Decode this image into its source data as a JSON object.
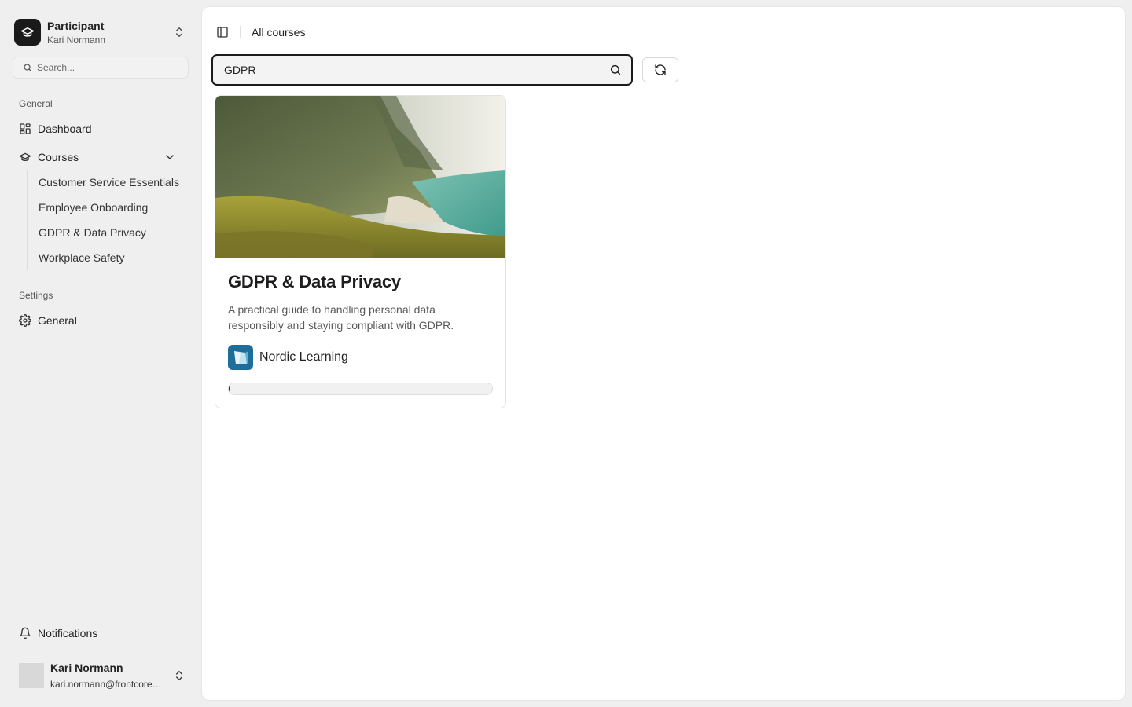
{
  "org": {
    "title": "Participant",
    "subtitle": "Kari Normann"
  },
  "sidebar": {
    "search_placeholder": "Search...",
    "general_label": "General",
    "dashboard_label": "Dashboard",
    "courses_label": "Courses",
    "course_items": [
      {
        "label": "Customer Service Essentials"
      },
      {
        "label": "Employee Onboarding"
      },
      {
        "label": "GDPR & Data Privacy"
      },
      {
        "label": "Workplace Safety"
      }
    ],
    "settings_label": "Settings",
    "settings_general_label": "General",
    "notifications_label": "Notifications"
  },
  "user": {
    "name": "Kari Normann",
    "email": "kari.normann@frontcore.com"
  },
  "header": {
    "breadcrumb": "All courses"
  },
  "main": {
    "search_value": "GDPR",
    "cards": [
      {
        "title": "GDPR & Data Privacy",
        "description": "A practical guide to handling personal data responsibly and staying compliant with GDPR.",
        "provider": "Nordic Learning",
        "progress_percent": 0
      }
    ]
  },
  "colors": {
    "accent": "#1b1b1b",
    "sidebar_bg": "#efefef",
    "content_bg": "#ffffff"
  },
  "icons": {
    "org_logo": "graduation-cap-icon",
    "search": "search-icon",
    "dashboard": "layout-grid-icon",
    "courses": "graduation-cap-icon",
    "settings": "gear-icon",
    "notifications": "bell-icon",
    "switcher": "chevrons-up-down-icon",
    "sidebar_toggle": "panel-left-icon",
    "refresh": "refresh-icon"
  }
}
